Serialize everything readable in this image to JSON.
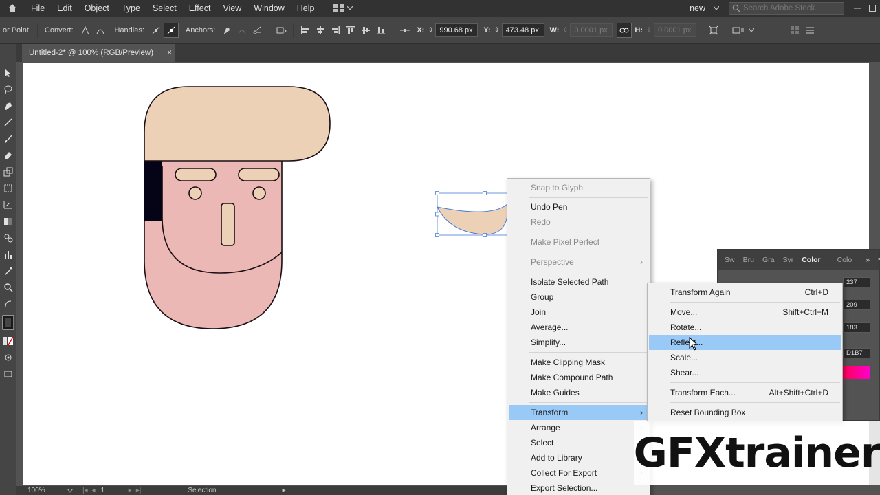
{
  "menubar": {
    "items": [
      "File",
      "Edit",
      "Object",
      "Type",
      "Select",
      "Effect",
      "View",
      "Window",
      "Help"
    ],
    "workspace": "new",
    "search_placeholder": "Search Adobe Stock"
  },
  "controlbar": {
    "tool_label": "or Point",
    "convert_label": "Convert:",
    "handles_label": "Handles:",
    "anchors_label": "Anchors:",
    "x_label": "X:",
    "x_value": "990.68 px",
    "y_label": "Y:",
    "y_value": "473.48 px",
    "w_label": "W:",
    "w_value": "0.0001 px",
    "h_label": "H:",
    "h_value": "0.0001 px"
  },
  "document": {
    "tab_title": "Untitled-2* @ 100% (RGB/Preview)",
    "close_glyph": "×"
  },
  "statusbar": {
    "zoom": "100%",
    "artboard_num": "1",
    "mode": "Selection"
  },
  "color_panel": {
    "tabs": [
      "Sw",
      "Bru",
      "Gra",
      "Syr",
      "Color",
      "Colo"
    ],
    "active_tab": "Color",
    "r_value": "237",
    "g_value": "209",
    "b_value": "183",
    "hex_value": "D1B7"
  },
  "context_menu": {
    "items": [
      {
        "label": "Snap to Glyph",
        "disabled": true
      },
      {
        "label": "Undo Pen",
        "disabled": false
      },
      {
        "label": "Redo",
        "disabled": true
      },
      {
        "label": "Make Pixel Perfect",
        "disabled": true
      },
      {
        "label": "Perspective",
        "disabled": true,
        "submenu": true
      },
      {
        "label": "Isolate Selected Path",
        "disabled": false
      },
      {
        "label": "Group",
        "disabled": false
      },
      {
        "label": "Join",
        "disabled": false
      },
      {
        "label": "Average...",
        "disabled": false
      },
      {
        "label": "Simplify...",
        "disabled": false
      },
      {
        "label": "Make Clipping Mask",
        "disabled": false
      },
      {
        "label": "Make Compound Path",
        "disabled": false
      },
      {
        "label": "Make Guides",
        "disabled": false
      },
      {
        "label": "Transform",
        "disabled": false,
        "submenu": true,
        "highlight": true
      },
      {
        "label": "Arrange",
        "disabled": false,
        "submenu": true
      },
      {
        "label": "Select",
        "disabled": false,
        "submenu": true
      },
      {
        "label": "Add to Library",
        "disabled": false
      },
      {
        "label": "Collect For Export",
        "disabled": false,
        "submenu": true
      },
      {
        "label": "Export Selection...",
        "disabled": false
      }
    ]
  },
  "transform_submenu": {
    "items": [
      {
        "label": "Transform Again",
        "shortcut": "Ctrl+D"
      },
      {
        "label": "Move...",
        "shortcut": "Shift+Ctrl+M"
      },
      {
        "label": "Rotate...",
        "shortcut": ""
      },
      {
        "label": "Reflect...",
        "shortcut": "",
        "highlight": true
      },
      {
        "label": "Scale...",
        "shortcut": ""
      },
      {
        "label": "Shear...",
        "shortcut": ""
      },
      {
        "label": "Transform Each...",
        "shortcut": "Alt+Shift+Ctrl+D"
      },
      {
        "label": "Reset Bounding Box",
        "shortcut": ""
      }
    ]
  },
  "watermark": "GFXtrainer",
  "colors": {
    "skin": "#ebb8b6",
    "hair": "#ecd1b7",
    "outline": "#1a0f14",
    "menu_highlight": "#99c9f7",
    "selection_blue": "#4a7bd8"
  }
}
